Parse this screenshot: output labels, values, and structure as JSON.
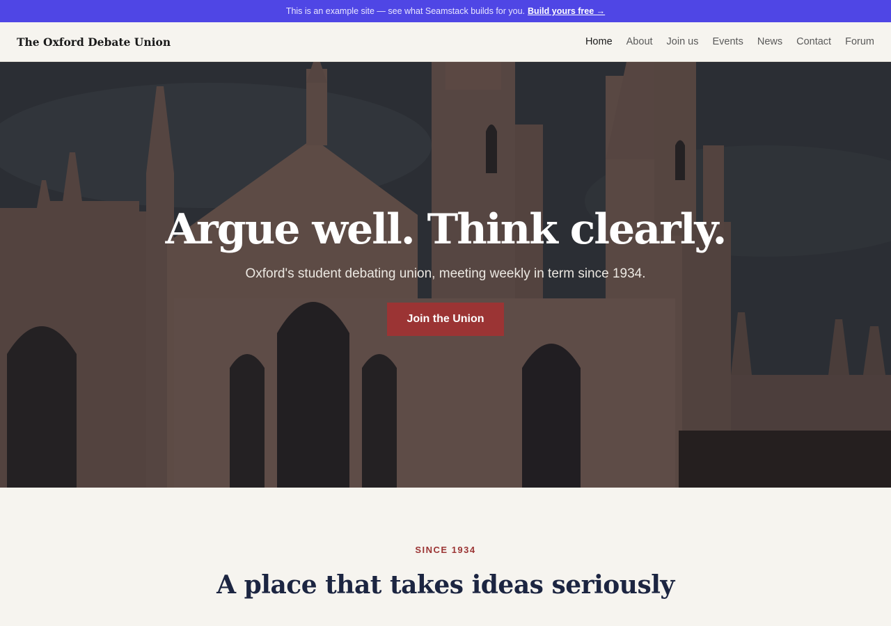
{
  "promo": {
    "text": "This is an example site — see what Seamstack builds for you.",
    "link": "Build yours free →"
  },
  "header": {
    "brand": "The Oxford Debate Union",
    "nav": [
      "Home",
      "About",
      "Join us",
      "Events",
      "News",
      "Contact",
      "Forum"
    ],
    "active": "Home"
  },
  "hero": {
    "title": "Argue well. Think clearly.",
    "subtitle": "Oxford's student debating union, meeting weekly in term since 1934.",
    "cta": "Join the Union"
  },
  "about": {
    "eyebrow": "SINCE 1934",
    "title": "A place that takes ideas seriously",
    "body": ""
  },
  "colors": {
    "promo": "#4f46e5",
    "accent": "#9b3434",
    "navy": "#1c2541",
    "background": "#f6f4ef"
  }
}
